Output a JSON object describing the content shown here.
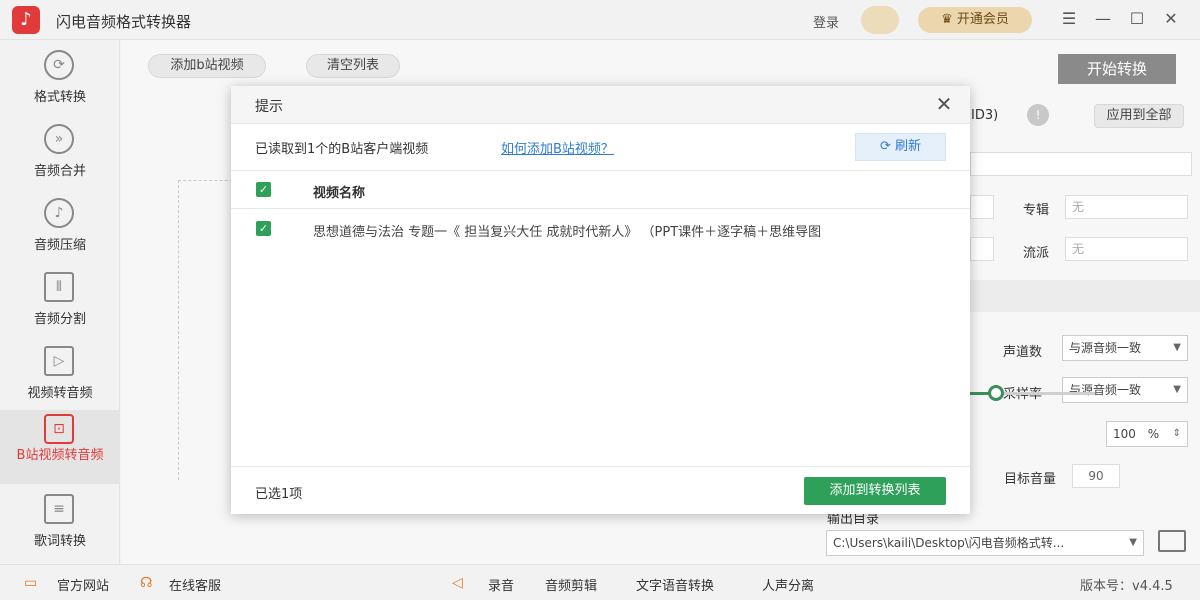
{
  "app": {
    "title": "闪电音频格式转换器",
    "logo_glyph": "♪",
    "login": "登录",
    "vip": "开通会员",
    "vip_icon": "♛"
  },
  "window_controls": {
    "menu": "☰",
    "minimize": "—",
    "maximize": "☐",
    "close": "✕"
  },
  "sidebar": {
    "items": [
      {
        "label": "格式转换",
        "icon": "⟳"
      },
      {
        "label": "音频合并",
        "icon": "»"
      },
      {
        "label": "音频压缩",
        "icon": "♪"
      },
      {
        "label": "音频分割",
        "icon": "⫴"
      },
      {
        "label": "视频转音频",
        "icon": "▷"
      },
      {
        "label": "B站视频转音频",
        "icon": "⊡",
        "active": true
      },
      {
        "label": "歌词转换",
        "icon": "≡"
      }
    ]
  },
  "toolbar": {
    "add_bilibili": "添加b站视频",
    "clear_list": "清空列表",
    "start": "开始转换"
  },
  "background_panel": {
    "id3_fragment": "ID3)",
    "apply_all": "应用到全部",
    "album_label": "专辑",
    "album_value": "无",
    "genre_label": "流派",
    "genre_value": "无",
    "channels_label": "声道数",
    "channels_value": "与源音频一致",
    "samplerate_label": "采样率",
    "samplerate_value": "与源音频一致",
    "volume_value": "100",
    "volume_unit": "%",
    "target_volume_label": "目标音量",
    "target_volume_value": "90",
    "output_dir_label": "输出目录",
    "output_path": "C:\\Users\\kaili\\Desktop\\闪电音频格式转...",
    "folder_icon": "folder-icon"
  },
  "dialog": {
    "title": "提示",
    "close": "✕",
    "info": "已读取到1个的B站客户端视频",
    "help_link": "如何添加B站视频？",
    "refresh": "刷新",
    "refresh_icon": "⟳",
    "column_header": "视频名称",
    "rows": [
      {
        "name": "思想道德与法治  专题一《 担当复兴大任 成就时代新人》 （PPT课件＋逐字稿＋思维导图",
        "checked": true
      }
    ],
    "selected_count": "已选1项",
    "add_button": "添加到转换列表",
    "check_glyph": "✓"
  },
  "footer": {
    "website": "官方网站",
    "support": "在线客服",
    "record": "录音",
    "audio_edit": "音频剪辑",
    "tts": "文字语音转换",
    "vocal_separation": "人声分离",
    "version": "版本号：v4.4.5"
  },
  "colors": {
    "accent_red": "#e03a3a",
    "accent_green": "#2ea05a",
    "link_blue": "#2e7bd6",
    "vip_gold": "#ecd6ad"
  }
}
